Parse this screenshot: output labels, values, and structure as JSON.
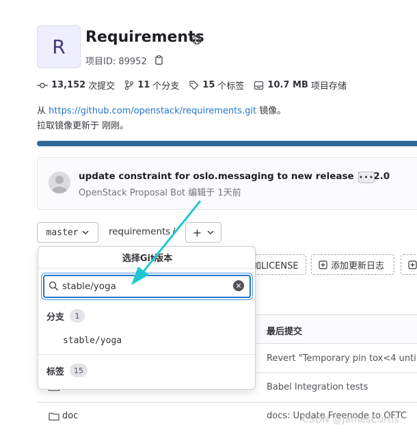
{
  "project": {
    "avatar_letter": "R",
    "title": "Requirements",
    "id_label": "项目ID: 89952"
  },
  "stats": {
    "commits": {
      "value": "13,152",
      "label": "次提交"
    },
    "branches": {
      "value": "11",
      "label": "个分支"
    },
    "tags": {
      "value": "15",
      "label": "个标签"
    },
    "storage": {
      "value": "10.7 MB",
      "label": "项目存储"
    }
  },
  "mirror": {
    "prefix": "从",
    "url": "https://github.com/openstack/requirements.git",
    "suffix": "镜像。",
    "updated": "拉取镜像更新于 刚刚。"
  },
  "last_commit": {
    "title": "update constraint for oslo.messaging to new release 14.2.0",
    "more": "•••",
    "author": "OpenStack Proposal Bot",
    "meta": "编辑于 1天前"
  },
  "toolbar": {
    "branch": "master",
    "path": "requirements",
    "slash": "/",
    "plus": "+"
  },
  "quick_actions": {
    "license": "加LICENSE",
    "changelog": "添加更新日志"
  },
  "table": {
    "last_commit_header": "最后提交",
    "rows": [
      {
        "message": "Revert \"Temporary pin tox<4 unti"
      },
      {
        "message": "Babel Integration tests"
      },
      {
        "name": "doc",
        "message": "docs: Update Freenode to OFTC"
      }
    ]
  },
  "dropdown": {
    "title": "选择Git版本",
    "search_value": "stable/yoga",
    "branches_label": "分支",
    "branches_count": "1",
    "branch_item": "stable/yoga",
    "tags_label": "标签",
    "tags_count": "15"
  },
  "watermark": "CSDN @JamesCurtis",
  "colors": {
    "accent": "#1f75cb",
    "arrow": "#1fc7d4",
    "progress": "#2f6a98"
  }
}
